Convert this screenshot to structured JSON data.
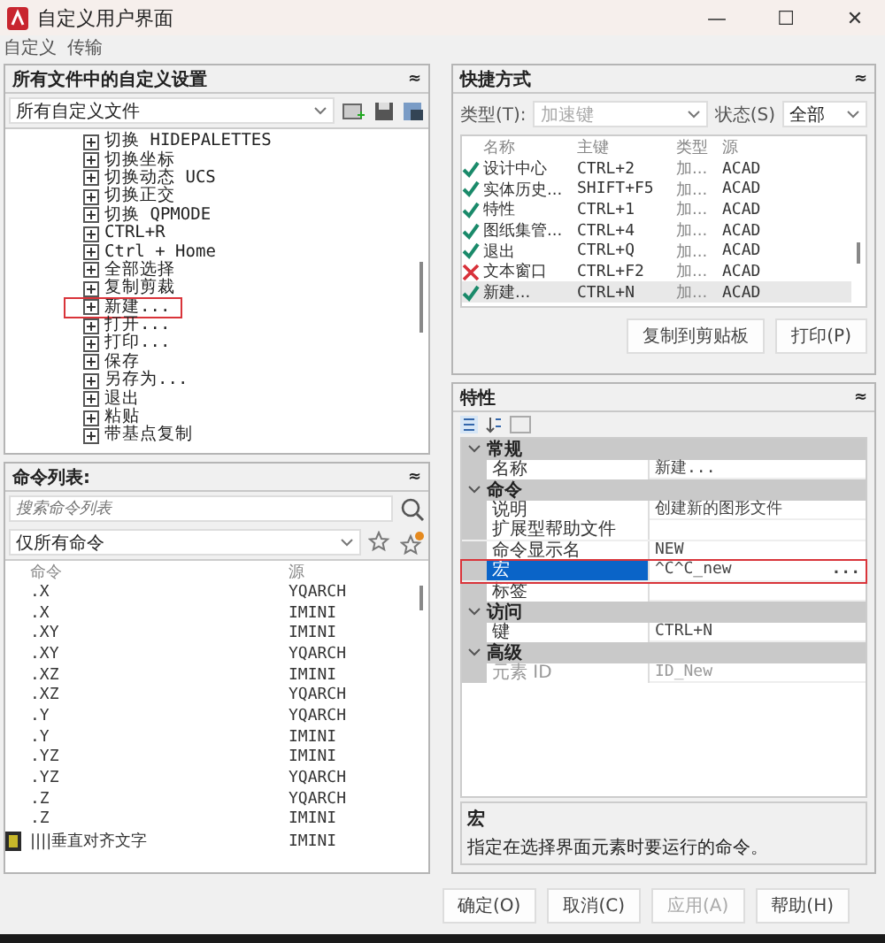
{
  "window": {
    "title": "自定义用户界面",
    "controls": [
      "—",
      "☐",
      "✕"
    ]
  },
  "menu": [
    "自定义",
    "传输"
  ],
  "customizations": {
    "title": "所有文件中的自定义设置",
    "collapse": "≈",
    "file_select": "所有自定义文件",
    "tree": [
      {
        "label": "切换 HIDEPALETTES",
        "highlighted": false
      },
      {
        "label": "切换坐标",
        "highlighted": false
      },
      {
        "label": "切换动态 UCS",
        "highlighted": false
      },
      {
        "label": "切换正交",
        "highlighted": false
      },
      {
        "label": "切换 QPMODE",
        "highlighted": false
      },
      {
        "label": "CTRL+R",
        "highlighted": false
      },
      {
        "label": "Ctrl + Home",
        "highlighted": false
      },
      {
        "label": "全部选择",
        "highlighted": false
      },
      {
        "label": "复制剪裁",
        "highlighted": false
      },
      {
        "label": "新建...",
        "highlighted": true
      },
      {
        "label": "打开...",
        "highlighted": false
      },
      {
        "label": "打印...",
        "highlighted": false
      },
      {
        "label": "保存",
        "highlighted": false
      },
      {
        "label": "另存为...",
        "highlighted": false
      },
      {
        "label": "退出",
        "highlighted": false
      },
      {
        "label": "粘贴",
        "highlighted": false
      },
      {
        "label": "带基点复制",
        "highlighted": false
      }
    ]
  },
  "command_list": {
    "title": "命令列表:",
    "search": {
      "placeholder": "搜索命令列表"
    },
    "filter": "仅所有命令",
    "columns": [
      "命令",
      "源"
    ],
    "rows": [
      {
        "command": ".X",
        "source": "YQARCH",
        "icon": false
      },
      {
        "command": ".X",
        "source": "IMINI",
        "icon": false
      },
      {
        "command": ".XY",
        "source": "IMINI",
        "icon": false
      },
      {
        "command": ".XY",
        "source": "YQARCH",
        "icon": false
      },
      {
        "command": ".XZ",
        "source": "IMINI",
        "icon": false
      },
      {
        "command": ".XZ",
        "source": "YQARCH",
        "icon": false
      },
      {
        "command": ".Y",
        "source": "YQARCH",
        "icon": false
      },
      {
        "command": ".Y",
        "source": "IMINI",
        "icon": false
      },
      {
        "command": ".YZ",
        "source": "IMINI",
        "icon": false
      },
      {
        "command": ".YZ",
        "source": "YQARCH",
        "icon": false
      },
      {
        "command": ".Z",
        "source": "YQARCH",
        "icon": false
      },
      {
        "command": ".Z",
        "source": "IMINI",
        "icon": false
      },
      {
        "command": "||||垂直对齐文字",
        "source": "IMINI",
        "icon": true
      }
    ]
  },
  "shortcuts": {
    "title": "快捷方式",
    "type_label": "类型(T):",
    "type_value": "加速键",
    "status_label": "状态(S)",
    "status_value": "全部",
    "columns": [
      "名称",
      "主键",
      "类型",
      "源"
    ],
    "rows": [
      {
        "name": "设计中心",
        "key": "CTRL+2",
        "type": "加...",
        "source": "ACAD",
        "valid": true,
        "selected": false
      },
      {
        "name": "实体历史...",
        "key": "SHIFT+F5",
        "type": "加...",
        "source": "ACAD",
        "valid": true,
        "selected": false
      },
      {
        "name": "特性",
        "key": "CTRL+1",
        "type": "加...",
        "source": "ACAD",
        "valid": true,
        "selected": false
      },
      {
        "name": "图纸集管...",
        "key": "CTRL+4",
        "type": "加...",
        "source": "ACAD",
        "valid": true,
        "selected": false
      },
      {
        "name": "退出",
        "key": "CTRL+Q",
        "type": "加...",
        "source": "ACAD",
        "valid": true,
        "selected": false
      },
      {
        "name": "文本窗口",
        "key": "CTRL+F2",
        "type": "加...",
        "source": "ACAD",
        "valid": false,
        "selected": false
      },
      {
        "name": "新建...",
        "key": "CTRL+N",
        "type": "加...",
        "source": "ACAD",
        "valid": true,
        "selected": true
      }
    ],
    "buttons": [
      "复制到剪贴板",
      "打印(P)"
    ]
  },
  "properties": {
    "title": "特性",
    "groups": [
      {
        "name": "常规",
        "rows": [
          {
            "label": "名称",
            "value": "新建...",
            "selected": false,
            "disabled": false,
            "highlighted": false
          }
        ]
      },
      {
        "name": "命令",
        "rows": [
          {
            "label": "说明",
            "value": "创建新的图形文件",
            "selected": false,
            "disabled": false,
            "highlighted": false
          },
          {
            "label": "扩展型帮助文件",
            "selected": false,
            "disabled": false,
            "highlighted": false
          },
          {
            "label": "命令显示名",
            "value": "NEW",
            "selected": false,
            "disabled": false,
            "highlighted": false
          },
          {
            "label": "宏",
            "value": "^C^C_new",
            "selected": true,
            "disabled": false,
            "highlighted": true,
            "ellipsis": "..."
          },
          {
            "label": "标签",
            "selected": false,
            "disabled": false,
            "highlighted": false
          }
        ]
      },
      {
        "name": "访问",
        "rows": [
          {
            "label": "键",
            "value": "CTRL+N",
            "selected": false,
            "disabled": false,
            "highlighted": false
          }
        ]
      },
      {
        "name": "高级",
        "rows": [
          {
            "label": "元素 ID",
            "value": "ID_New",
            "selected": false,
            "disabled": true,
            "highlighted": false
          }
        ]
      }
    ],
    "description_title": "宏",
    "description": "指定在选择界面元素时要运行的命令。"
  },
  "footer_buttons": [
    {
      "label": "确定(O)",
      "disabled": false
    },
    {
      "label": "取消(C)",
      "disabled": false
    },
    {
      "label": "应用(A)",
      "disabled": true
    },
    {
      "label": "帮助(H)",
      "disabled": false
    }
  ]
}
